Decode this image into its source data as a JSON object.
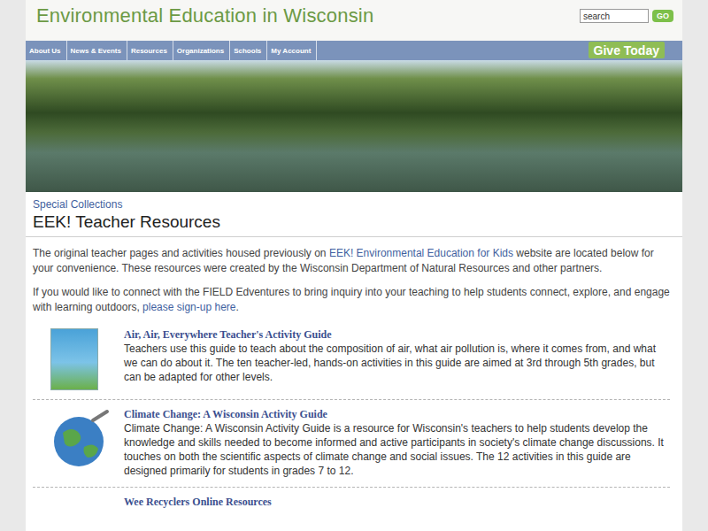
{
  "header": {
    "title": "Environmental Education in Wisconsin",
    "search": {
      "placeholder": "search"
    },
    "go_button": "GO"
  },
  "nav": {
    "items": [
      {
        "label": "About Us"
      },
      {
        "label": "News & Events"
      },
      {
        "label": "Resources"
      },
      {
        "label": "Organizations"
      },
      {
        "label": "Schools"
      },
      {
        "label": "My Account"
      }
    ],
    "give_button": "Give Today"
  },
  "breadcrumb": "Special Collections",
  "page_title": "EEK! Teacher Resources",
  "intro": [
    [
      {
        "text": "The original teacher pages and activities housed previously on ",
        "link": false
      },
      {
        "text": "EEK! Environmental Education for Kids",
        "link": true
      },
      {
        "text": " website are located below for your convenience. These resources were created by the Wisconsin Department of Natural Resources and other partners.",
        "link": false
      }
    ],
    [
      {
        "text": "If you would like to connect with the FIELD Edventures to bring inquiry into your teaching to help students connect, explore, and engage with learning outdoors, ",
        "link": false
      },
      {
        "text": "please sign-up here",
        "link": true
      },
      {
        "text": ".",
        "link": false
      }
    ]
  ],
  "resources": [
    {
      "kind": "book",
      "title": "Air, Air, Everywhere Teacher's Activity Guide",
      "description": "Teachers use this guide to teach about the composition of air, what air pollution is, where it comes from, and what we can do about it. The ten teacher-led, hands-on activities in this guide are aimed at 3rd through 5th grades, but can be adapted for other levels."
    },
    {
      "kind": "globe",
      "title": "Climate Change: A Wisconsin Activity Guide",
      "description": "Climate Change: A Wisconsin Activity Guide is a resource for Wisconsin's teachers to help students develop the knowledge and skills needed to become informed and active participants in society's climate change discussions. It touches on both the scientific aspects of climate change and social issues. The 12 activities in this guide are designed primarily for students in grades 7 to 12."
    },
    {
      "kind": "none",
      "title": "Wee Recyclers Online Resources",
      "description": ""
    }
  ]
}
